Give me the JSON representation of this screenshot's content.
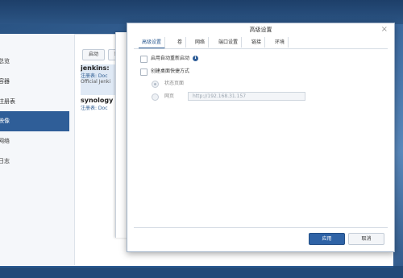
{
  "background_window": {
    "sidebar_items": [
      "总览",
      "容器",
      "注册表",
      "映像",
      "网络",
      "日志"
    ],
    "active_index": 3,
    "toolbar": [
      "启动",
      "新"
    ],
    "images": [
      {
        "name": "jenkins:",
        "sub1": "注册表: Doc",
        "sub2": "Official Jenki"
      },
      {
        "name": "synology",
        "sub1": "注册表: Doc"
      }
    ]
  },
  "dialog": {
    "title": "高级设置",
    "tabs": [
      "高级设置",
      "卷",
      "网络",
      "端口设置",
      "链接",
      "环境"
    ],
    "active_tab": 0,
    "options": {
      "auto_restart_label": "启用自动重新启动",
      "desktop_shortcut_label": "创建桌面快捷方式",
      "status_page_label": "状态页面",
      "web_page_label": "网页",
      "web_page_url": "http://192.168.31.157"
    },
    "buttons": {
      "apply": "应用",
      "cancel": "取消"
    }
  },
  "colors": {
    "accent": "#2f5e98",
    "apply_button": "#2f63a6",
    "desktop": "#3c6aa0"
  },
  "icons": {
    "info": "info-icon",
    "close": "close-icon"
  }
}
